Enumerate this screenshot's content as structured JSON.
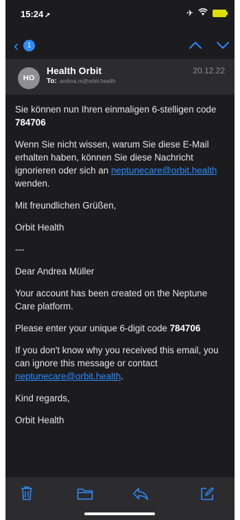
{
  "status": {
    "time": "15:24",
    "location_icon": "location-arrow-icon",
    "icons": [
      "airplane-icon",
      "wifi-icon",
      "battery-charging-icon"
    ]
  },
  "nav": {
    "badge_count": "1"
  },
  "email": {
    "avatar_initials": "HO",
    "sender": "Health Orbit",
    "to_label": "To:",
    "to_address": "andrea.m@orbit.health",
    "date": "20.12.22",
    "body": {
      "de_code_intro": "Sie können nun Ihren einmaligen 6-stelligen code",
      "de_code": "784706",
      "de_help_pre": "Wenn Sie nicht wissen, warum Sie diese E-Mail erhalten haben, können Sie diese Nachricht ignorieren oder sich an",
      "de_help_link": "neptunecare@orbit.health",
      "de_help_post": "wenden.",
      "de_regards": "Mit freundlichen Grüßen,",
      "de_sign": "Orbit Health",
      "separator": "---",
      "en_greeting": "Dear Andrea Müller",
      "en_created": "Your account has been created on the Neptune Care platform.",
      "en_code_intro": "Please enter your unique 6-digit code",
      "en_code": "784706",
      "en_help_pre": "If you don't know why you received this email, you can ignore this message or contact",
      "en_help_link": "neptunecare@orbit.health",
      "en_help_post": ".",
      "en_regards": "Kind regards,",
      "en_sign": "Orbit Health"
    }
  },
  "toolbar": [
    "trash-icon",
    "folder-icon",
    "reply-icon",
    "compose-icon"
  ],
  "colors": {
    "accent": "#2b8cff",
    "background": "#1c1c1e",
    "header": "#2c2c2e"
  }
}
